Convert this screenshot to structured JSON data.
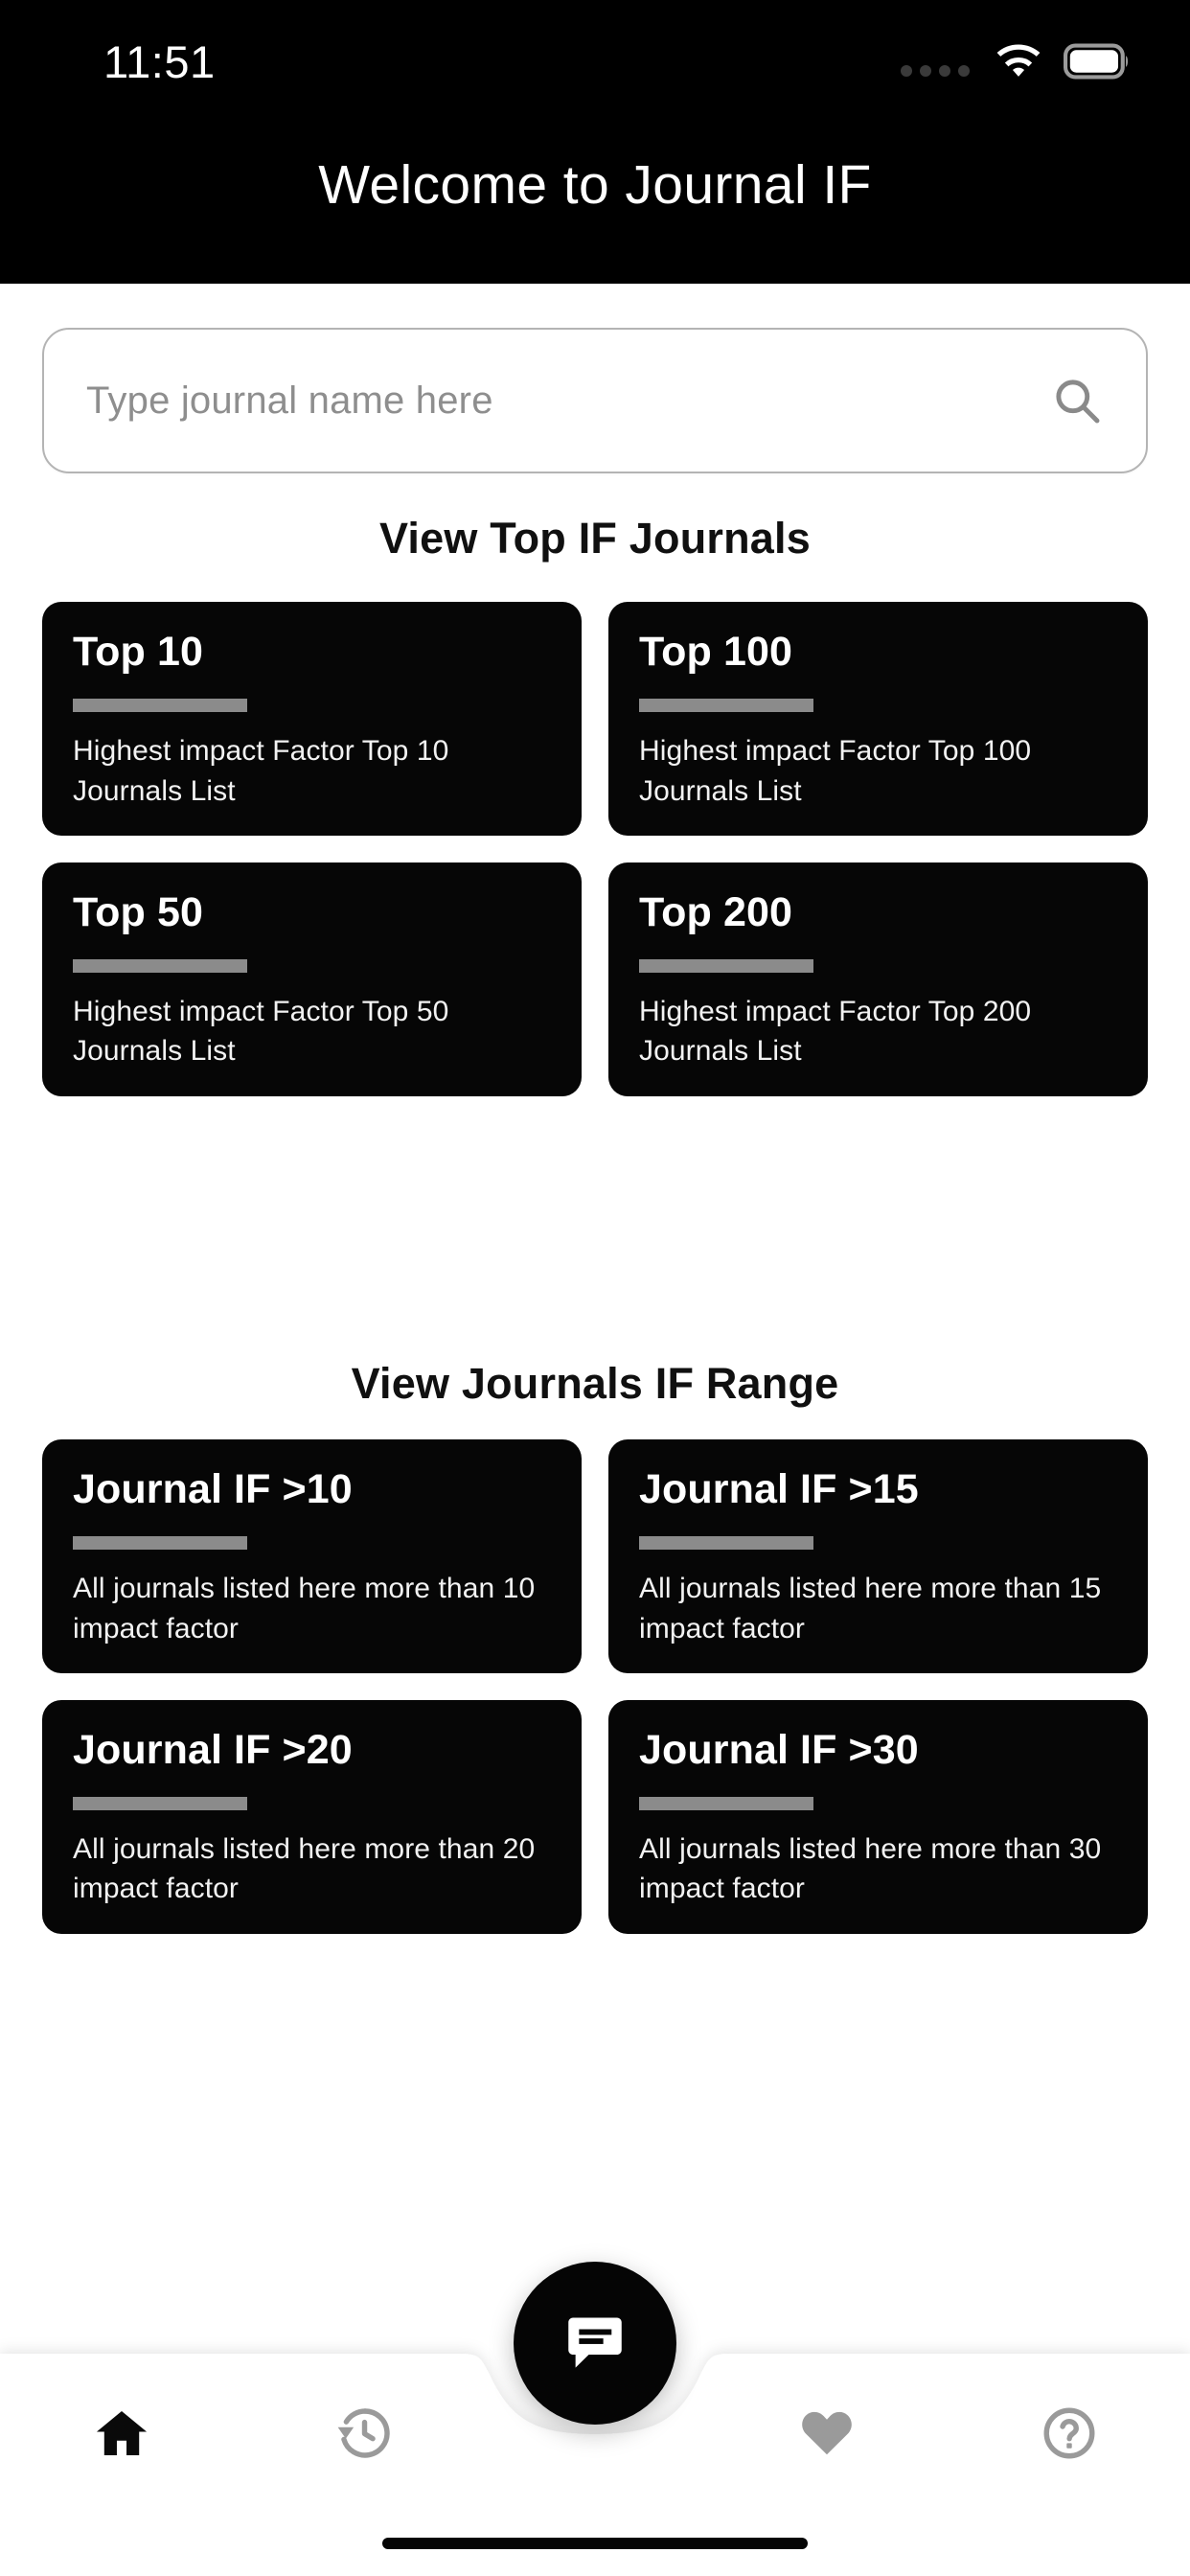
{
  "status_bar": {
    "time": "11:51",
    "icons": [
      "signal-dots-icon",
      "wifi-icon",
      "battery-icon"
    ]
  },
  "header": {
    "title": "Welcome to Journal IF",
    "background_color": "#000000",
    "text_color": "#ffffff"
  },
  "search": {
    "placeholder": "Type journal name here",
    "value": "",
    "icon": "search-icon"
  },
  "sections": [
    {
      "id": "top-if-journals",
      "heading": "View Top IF Journals",
      "cards": [
        {
          "title": "Top 10",
          "description": "Highest impact Factor Top 10 Journals List"
        },
        {
          "title": "Top 100",
          "description": "Highest impact Factor Top 100 Journals List"
        },
        {
          "title": "Top 50",
          "description": "Highest impact Factor Top 50 Journals List"
        },
        {
          "title": "Top 200",
          "description": "Highest impact Factor Top 200 Journals List"
        }
      ]
    },
    {
      "id": "journals-if-range",
      "heading": "View Journals IF Range",
      "cards": [
        {
          "title": "Journal IF >10",
          "description": "All journals listed here more than 10 impact factor"
        },
        {
          "title": "Journal IF >15",
          "description": "All journals listed here more than 15 impact factor"
        },
        {
          "title": "Journal IF >20",
          "description": "All journals listed here more than 20 impact factor"
        },
        {
          "title": "Journal IF >30",
          "description": "All journals listed here more than 30 impact factor"
        }
      ]
    }
  ],
  "fab": {
    "icon": "chat-bubble-icon",
    "background_color": "#050505",
    "icon_color": "#ffffff"
  },
  "bottom_nav": {
    "items": [
      {
        "icon": "home-icon",
        "active": true,
        "color": "#0a0a0a"
      },
      {
        "icon": "history-icon",
        "active": false,
        "color": "#9a9a9a"
      },
      {
        "icon": "heart-icon",
        "active": false,
        "color": "#9a9a9a"
      },
      {
        "icon": "help-circle-icon",
        "active": false,
        "color": "#9a9a9a"
      }
    ]
  },
  "colors": {
    "card_background": "#060606",
    "card_rule": "#8b8b8b",
    "page_background": "#ffffff",
    "search_border": "#b4b4b4",
    "placeholder": "#8e8e8e"
  }
}
